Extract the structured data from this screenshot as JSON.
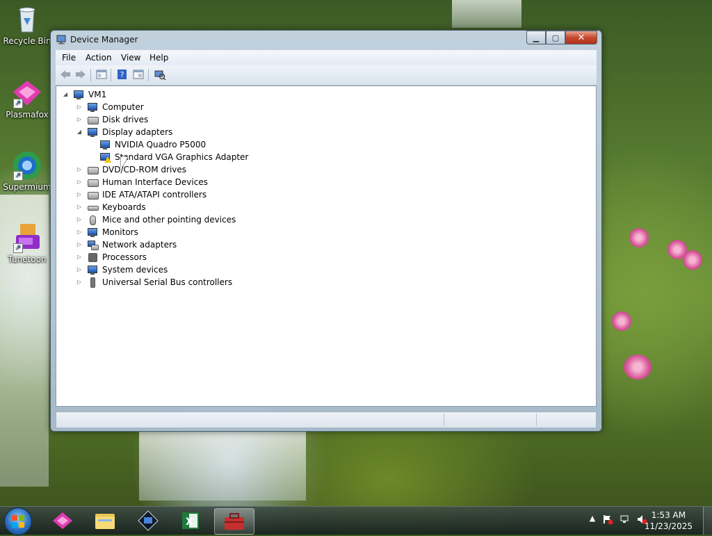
{
  "desktop": {
    "icons": [
      {
        "label": "Recycle Bin",
        "icon": "recycle-bin-icon"
      },
      {
        "label": "Plasmafox",
        "icon": "plasmafox-icon"
      },
      {
        "label": "Supermium",
        "icon": "supermium-icon"
      },
      {
        "label": "Tunetoon",
        "icon": "tunetoon-icon"
      }
    ]
  },
  "window": {
    "title": "Device Manager",
    "menu": [
      "File",
      "Action",
      "View",
      "Help"
    ],
    "toolbar": [
      "back-icon",
      "forward-icon",
      "properties-icon",
      "help-icon",
      "view-icon",
      "scan-hardware-icon"
    ],
    "tree": {
      "root": "VM1",
      "items": [
        {
          "label": "Computer",
          "expanded": false
        },
        {
          "label": "Disk drives",
          "expanded": false
        },
        {
          "label": "Display adapters",
          "expanded": true,
          "children": [
            {
              "label": "NVIDIA Quadro P5000",
              "warning": false
            },
            {
              "label": "Standard VGA Graphics Adapter",
              "warning": true
            }
          ]
        },
        {
          "label": "DVD/CD-ROM drives",
          "expanded": false
        },
        {
          "label": "Human Interface Devices",
          "expanded": false
        },
        {
          "label": "IDE ATA/ATAPI controllers",
          "expanded": false
        },
        {
          "label": "Keyboards",
          "expanded": false
        },
        {
          "label": "Mice and other pointing devices",
          "expanded": false
        },
        {
          "label": "Monitors",
          "expanded": false
        },
        {
          "label": "Network adapters",
          "expanded": false
        },
        {
          "label": "Processors",
          "expanded": false
        },
        {
          "label": "System devices",
          "expanded": false
        },
        {
          "label": "Universal Serial Bus controllers",
          "expanded": false
        }
      ]
    }
  },
  "taskbar": {
    "pinned": [
      "plasmafox-icon",
      "file-explorer-icon",
      "supermium-app-icon",
      "excel-icon",
      "toolbox-icon"
    ],
    "active": "toolbox-icon",
    "clock": {
      "time": "1:53 AM",
      "date": "11/23/2025"
    }
  }
}
